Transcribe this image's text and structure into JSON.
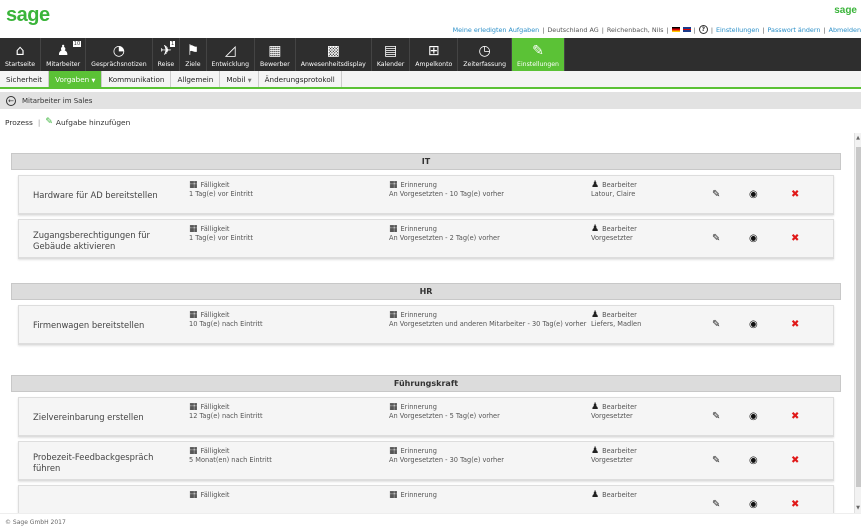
{
  "brand": {
    "logo": "sage",
    "logo_small": "sage"
  },
  "toplinks": {
    "done_tasks": "Meine erledigten Aufgaben",
    "company": "Deutschland AG",
    "user": "Reichenbach, Nils",
    "help": "?",
    "settings": "Einstellungen",
    "password": "Passwort ändern",
    "logout": "Abmelden"
  },
  "nav": [
    {
      "label": "Startseite",
      "icon": "home-icon",
      "glyph": "⌂"
    },
    {
      "label": "Mitarbeiter",
      "icon": "person-icon",
      "glyph": "♟",
      "badge": "10"
    },
    {
      "label": "Gesprächsnotizen",
      "icon": "chat-icon",
      "glyph": "◔"
    },
    {
      "label": "Reise",
      "icon": "plane-icon",
      "glyph": "✈",
      "badge": "1"
    },
    {
      "label": "Ziele",
      "icon": "flag-icon",
      "glyph": "⚑"
    },
    {
      "label": "Entwicklung",
      "icon": "growth-chart-icon",
      "glyph": "◿"
    },
    {
      "label": "Bewerber",
      "icon": "applicant-file-icon",
      "glyph": "▦"
    },
    {
      "label": "Anwesenheitsdisplay",
      "icon": "grid-icon",
      "glyph": "▩"
    },
    {
      "label": "Kalender",
      "icon": "calendar-icon",
      "glyph": "▤"
    },
    {
      "label": "Ampelkonto",
      "icon": "traffic-light-icon",
      "glyph": "⊞"
    },
    {
      "label": "Zeiterfassung",
      "icon": "clock-icon",
      "glyph": "◷"
    },
    {
      "label": "Einstellungen",
      "icon": "wrench-icon",
      "glyph": "✎"
    }
  ],
  "subnav": [
    {
      "label": "Sicherheit"
    },
    {
      "label": "Vorgaben"
    },
    {
      "label": "Kommunikation"
    },
    {
      "label": "Allgemein"
    },
    {
      "label": "Mobil"
    },
    {
      "label": "Änderungsprotokoll"
    }
  ],
  "breadcrumb": {
    "title": "Mitarbeiter im Sales"
  },
  "toolbar": {
    "process": "Prozess",
    "add_task": "Aufgabe hinzufügen"
  },
  "labels": {
    "due": "Fälligkeit",
    "reminder": "Erinnerung",
    "editor": "Bearbeiter"
  },
  "sections": [
    {
      "title": "IT",
      "tasks": [
        {
          "title": "Hardware für AD bereitstellen",
          "due": "1 Tag(e) vor Eintritt",
          "reminder": "An Vorgesetzten - 10 Tag(e) vorher",
          "editor": "Latour, Claire"
        },
        {
          "title": "Zugangsberechtigungen für Gebäude aktivieren",
          "due": "1 Tag(e) vor Eintritt",
          "reminder": "An Vorgesetzten - 2 Tag(e) vorher",
          "editor": "Vorgesetzter"
        }
      ]
    },
    {
      "title": "HR",
      "tasks": [
        {
          "title": "Firmenwagen bereitstellen",
          "due": "10 Tag(e) nach Eintritt",
          "reminder": "An Vorgesetzten und anderen Mitarbeiter - 30 Tag(e) vorher",
          "editor": "Liefers, Madlen"
        }
      ]
    },
    {
      "title": "Führungskraft",
      "tasks": [
        {
          "title": "Zielvereinbarung erstellen",
          "due": "12 Tag(e) nach Eintritt",
          "reminder": "An Vorgesetzten - 5 Tag(e) vorher",
          "editor": "Vorgesetzter"
        },
        {
          "title": "Probezeit-Feedbackgespräch führen",
          "due": "5 Monat(en) nach Eintritt",
          "reminder": "An Vorgesetzten - 30 Tag(e) vorher",
          "editor": "Vorgesetzter"
        },
        {
          "title": "",
          "due": "",
          "reminder": "",
          "editor": ""
        }
      ]
    }
  ],
  "footer": {
    "copyright": "© Sage GmbH 2017"
  },
  "colors": {
    "accent": "#5bc236",
    "navbar": "#2e2e2e",
    "delete": "#e01818",
    "link": "#2a8fc8"
  }
}
